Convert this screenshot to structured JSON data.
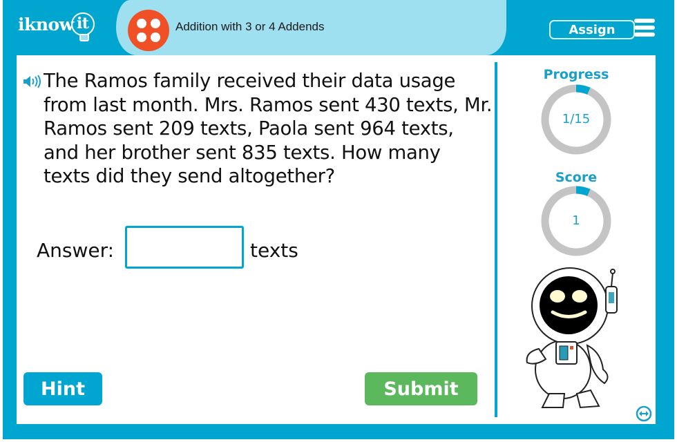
{
  "header": {
    "logo_text": "iknow",
    "logo_bulb_text": "it",
    "lesson_title": "Addition with 3 or 4 Addends",
    "assign_label": "Assign",
    "menu_icon": "hamburger-menu-icon"
  },
  "question": {
    "text": "The Ramos family received their data usage from last month. Mrs. Ramos sent 430 texts, Mr. Ramos sent 209 texts, Paola sent 964 texts, and her brother sent 835 texts. How many texts did they send altogether?",
    "speaker_icon": "speaker-icon"
  },
  "answer": {
    "label": "Answer:",
    "value": "",
    "placeholder": "",
    "unit": "texts"
  },
  "buttons": {
    "hint": "Hint",
    "submit": "Submit"
  },
  "sidebar": {
    "progress": {
      "label": "Progress",
      "text": "1/15",
      "fraction": 0.0667
    },
    "score": {
      "label": "Score",
      "text": "1",
      "fraction": 0.0667
    },
    "mascot": "astronaut",
    "expand_icon": "expand-arrows-icon"
  },
  "colors": {
    "brand_blue": "#00a6cf",
    "light_blue": "#9edff0",
    "lesson_orange": "#ef5025",
    "submit_green": "#5cb85c",
    "ring_gray": "#c4c4c4"
  }
}
